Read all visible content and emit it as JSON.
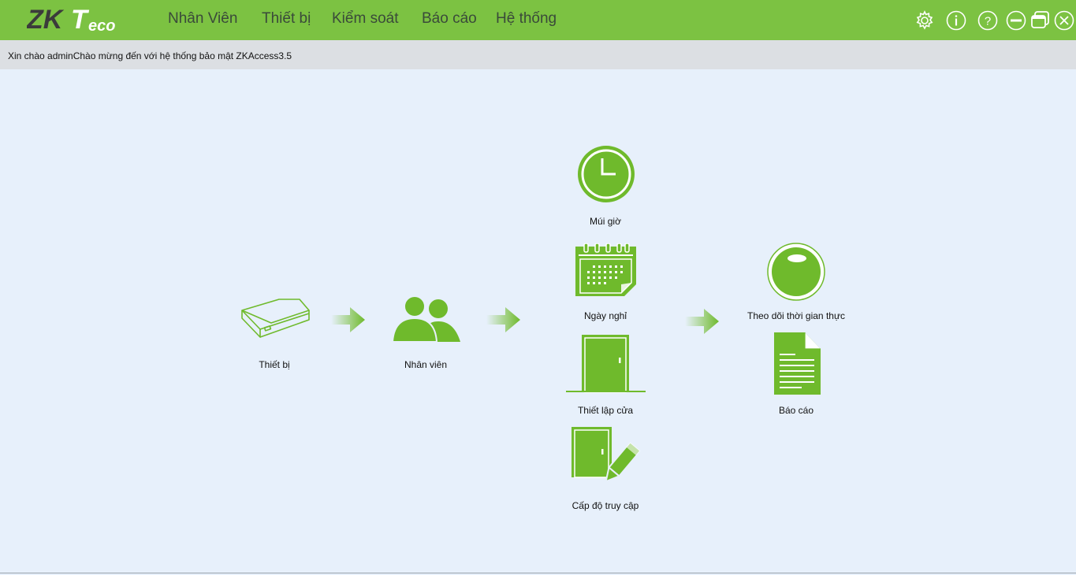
{
  "brand": {
    "logo_text": "ZKTeco"
  },
  "menu": {
    "employees": "Nhân Viên",
    "devices": "Thiết bị",
    "access": "Kiểm soát",
    "reports": "Báo cáo",
    "system": "Hệ thống"
  },
  "window_icons": [
    "gear-icon",
    "info-icon",
    "help-icon",
    "minimize-icon",
    "restore-icon",
    "close-icon"
  ],
  "greeting": {
    "user": "Xin chào admin",
    "welcome": "Chào mừng đến với hệ thống bảo mật ZKAccess3.5"
  },
  "workflow": {
    "device": "Thiết bị",
    "personnel": "Nhân viên",
    "time_zone": "Múi giờ",
    "holidays": "Ngày nghỉ",
    "door_setup": "Thiết lập cửa",
    "access_level": "Cấp độ truy cập",
    "realtime_monitor": "Theo dõi thời gian thực",
    "report": "Báo cáo"
  },
  "colors": {
    "accent_green": "#7cc242",
    "icon_green": "#6fba2c",
    "background": "#e7f0fb",
    "greeting_bar": "#dcdfe3"
  }
}
